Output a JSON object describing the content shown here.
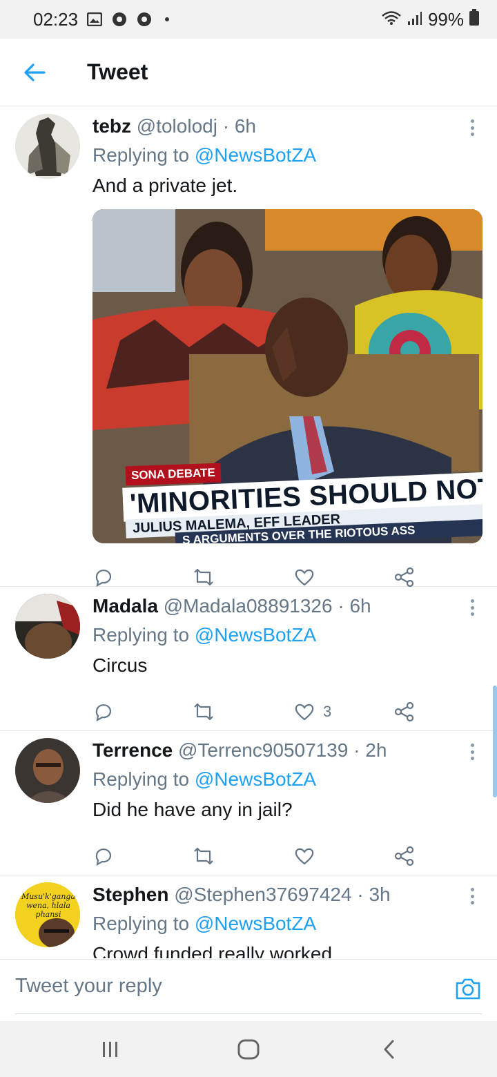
{
  "status_bar": {
    "time": "02:23",
    "battery": "99%",
    "icons": [
      "image-icon",
      "chrome-icon",
      "chrome-icon",
      "wifi-icon",
      "signal-icon",
      "battery-icon"
    ]
  },
  "header": {
    "title": "Tweet",
    "back_icon": "arrow-left-icon"
  },
  "colors": {
    "accent": "#1da1f2",
    "text": "#14171a",
    "muted": "#657786",
    "divider": "#e1e8ed"
  },
  "tweets": [
    {
      "name": "tebz",
      "handle": "@tololodj",
      "time": "· 6h",
      "replying_prefix": "Replying to",
      "replying_to": "@NewsBotZA",
      "text": "And a private jet.",
      "like_count": "",
      "media": {
        "tag": "SONA DEBATE",
        "headline": "'MINORITIES SHOULD NOT",
        "subline": "JULIUS MALEMA, EFF LEADER",
        "ticker": "S ARGUMENTS OVER THE RIOTOUS ASS"
      }
    },
    {
      "name": "Madala",
      "handle": "@Madala08891326",
      "time": "· 6h",
      "replying_prefix": "Replying to",
      "replying_to": "@NewsBotZA",
      "text": "Circus",
      "like_count": "3"
    },
    {
      "name": "Terrence",
      "handle": "@Terrenc90507139",
      "time": "· 2h",
      "replying_prefix": "Replying to",
      "replying_to": "@NewsBotZA",
      "text": "Did he have any in jail?",
      "like_count": ""
    },
    {
      "name": "Stephen",
      "handle": "@Stephen37697424",
      "time": "· 3h",
      "replying_prefix": "Replying to",
      "replying_to": "@NewsBotZA",
      "text": "Crowd funded really worked",
      "avatar_text": "Musu'k'ganga wena, hlala phansi"
    }
  ],
  "reply_bar": {
    "placeholder": "Tweet your reply",
    "camera_icon": "camera-icon"
  },
  "nav_bar": {
    "icons": [
      "recent-apps-icon",
      "home-icon",
      "back-icon"
    ]
  }
}
